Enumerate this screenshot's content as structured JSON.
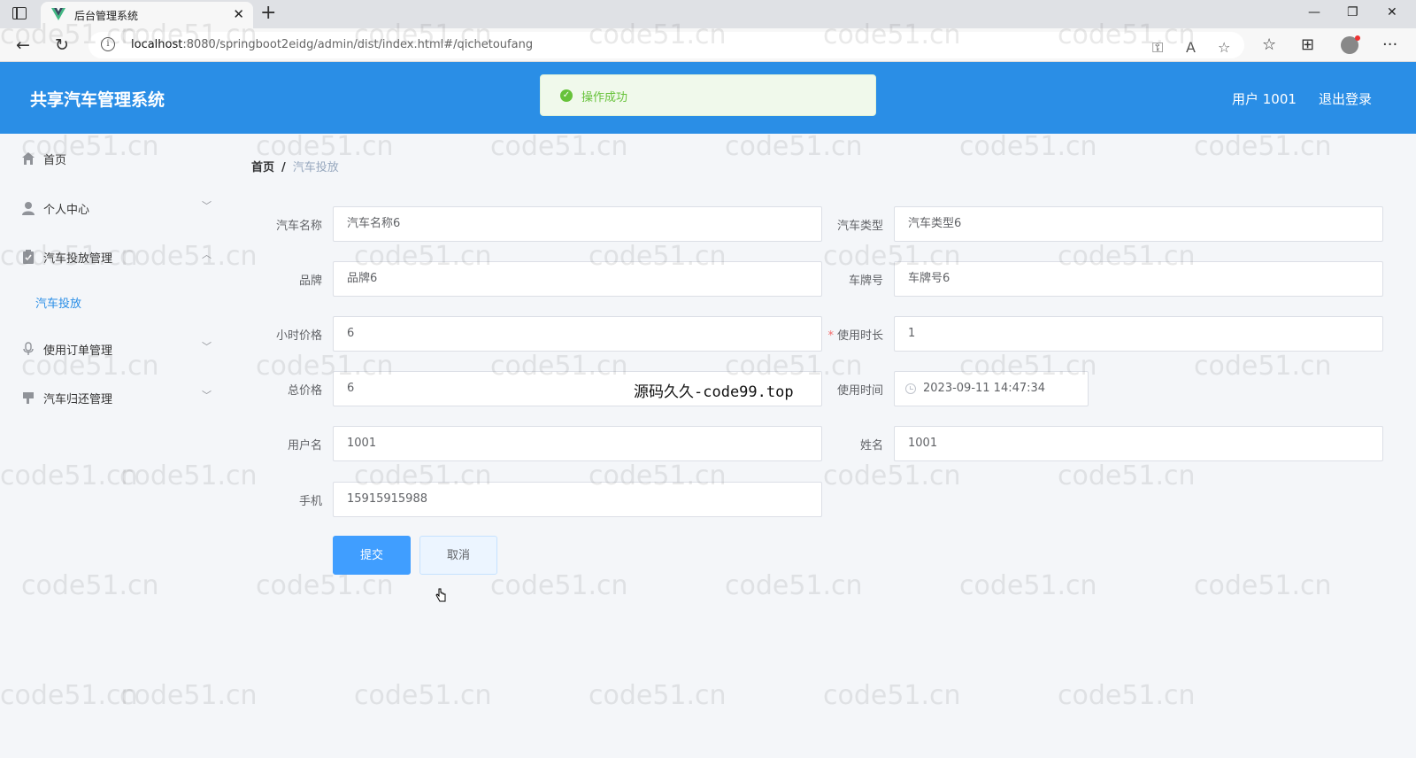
{
  "browser": {
    "tab_title": "后台管理系统",
    "tab_close": "✕",
    "new_tab": "+",
    "url_host": "localhost",
    "url_rest": ":8080/springboot2eidg/admin/dist/index.html#/qichetoufang"
  },
  "header": {
    "title": "共享汽车管理系统",
    "user": "用户 1001",
    "logout": "退出登录"
  },
  "toast": {
    "text": "操作成功"
  },
  "sidebar": {
    "items": [
      {
        "label": "首页",
        "icon": "home-icon"
      },
      {
        "label": "个人中心",
        "icon": "user-icon"
      },
      {
        "label": "汽车投放管理",
        "icon": "clipboard-icon"
      },
      {
        "label": "汽车投放",
        "icon": ""
      },
      {
        "label": "使用订单管理",
        "icon": "microphone-icon"
      },
      {
        "label": "汽车归还管理",
        "icon": "flag-icon"
      }
    ]
  },
  "breadcrumb": {
    "home": "首页",
    "separator": "/",
    "current": "汽车投放"
  },
  "form": {
    "car_name": {
      "label": "汽车名称",
      "value": "汽车名称6"
    },
    "car_type": {
      "label": "汽车类型",
      "value": "汽车类型6"
    },
    "brand": {
      "label": "品牌",
      "value": "品牌6"
    },
    "plate": {
      "label": "车牌号",
      "value": "车牌号6"
    },
    "hourly_price": {
      "label": "小时价格",
      "value": "6"
    },
    "duration": {
      "label": "使用时长",
      "value": "1",
      "required_mark": "*"
    },
    "total_price": {
      "label": "总价格",
      "value": "6"
    },
    "use_time": {
      "label": "使用时间",
      "value": "2023-09-11 14:47:34"
    },
    "username": {
      "label": "用户名",
      "value": "1001"
    },
    "name": {
      "label": "姓名",
      "value": "1001"
    },
    "phone": {
      "label": "手机",
      "value": "15915915988"
    },
    "submit": "提交",
    "cancel": "取消"
  },
  "overlay_text": "源码久久-code99.top",
  "watermark": "code51.cn",
  "colors": {
    "header": "#2a8ee6",
    "primary": "#409eff",
    "success": "#67c23a"
  }
}
